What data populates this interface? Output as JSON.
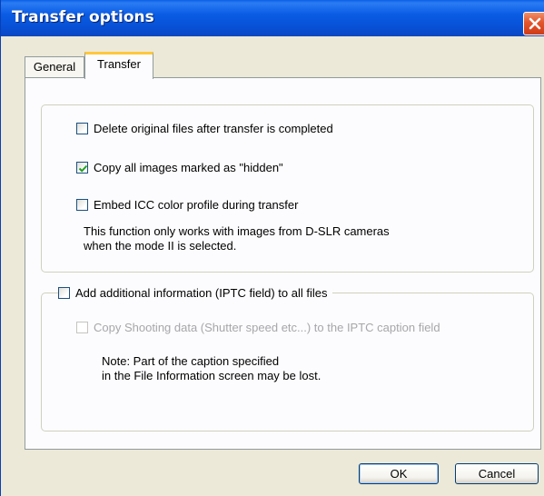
{
  "window": {
    "title": "Transfer options",
    "titlebar_color": "#0a5be4",
    "close_icon": "close-icon"
  },
  "tabs": [
    {
      "label": "General",
      "active": false
    },
    {
      "label": "Transfer",
      "active": true
    }
  ],
  "transfer": {
    "delete_original": {
      "label": "Delete original files after transfer is completed",
      "checked": false
    },
    "copy_hidden": {
      "label": "Copy all images marked as \"hidden\"",
      "checked": true
    },
    "embed_icc": {
      "label": "Embed ICC color profile during transfer",
      "checked": false
    },
    "icc_note_line1": "This function only works with images from D-SLR cameras",
    "icc_note_line2": "when the mode II is selected.",
    "add_iptc": {
      "label": "Add additional information (IPTC field) to all files",
      "checked": false
    },
    "copy_shooting": {
      "label": "Copy Shooting data (Shutter speed etc...) to the IPTC caption field",
      "checked": false,
      "enabled": false
    },
    "iptc_note_line1": "Note: Part of the caption specified",
    "iptc_note_line2": "in the File Information screen may be lost."
  },
  "buttons": {
    "ok_label": "OK",
    "cancel_label": "Cancel"
  },
  "colors": {
    "dialog_bg": "#ece9d8",
    "active_tab_accent": "#ffc73c",
    "checkmark": "#21a121"
  }
}
